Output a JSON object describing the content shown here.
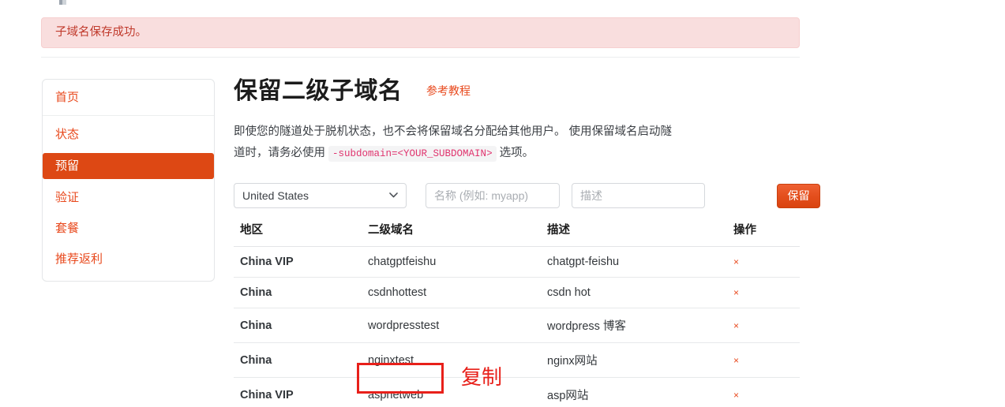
{
  "alert": {
    "message": "子域名保存成功。",
    "type": "danger"
  },
  "sidebar": {
    "header": {
      "label": "首页"
    },
    "items": [
      {
        "label": "状态",
        "active": false
      },
      {
        "label": "预留",
        "active": true
      },
      {
        "label": "验证",
        "active": false
      },
      {
        "label": "套餐",
        "active": false
      },
      {
        "label": "推荐返利",
        "active": false
      }
    ]
  },
  "main": {
    "title": "保留二级子域名",
    "tutorial_link": "参考教程",
    "description_part1": "即使您的隧道处于脱机状态，也不会将保留域名分配给其他用户。 使用保留域名启动隧道时，请务必使用",
    "description_code": "-subdomain=<YOUR_SUBDOMAIN>",
    "description_part2": "选项。"
  },
  "form": {
    "region_selected": "United States",
    "region_options": [
      "United States"
    ],
    "name_value": "",
    "name_placeholder": "名称 (例如: myapp)",
    "desc_value": "",
    "desc_placeholder": "描述",
    "submit_label": "保留",
    "chevron": "❯"
  },
  "table": {
    "headers": [
      "地区",
      "二级域名",
      "描述",
      "操作"
    ],
    "delete_icon": "×",
    "rows": [
      {
        "region": "China VIP",
        "subdomain": "chatgptfeishu",
        "desc": "chatgpt-feishu"
      },
      {
        "region": "China",
        "subdomain": "csdnhottest",
        "desc": "csdn hot"
      },
      {
        "region": "China",
        "subdomain": "wordpresstest",
        "desc": "wordpress 博客"
      },
      {
        "region": "China",
        "subdomain": "nginxtest",
        "desc": "nginx网站"
      },
      {
        "region": "China VIP",
        "subdomain": "aspnetweb",
        "desc": "asp网站"
      }
    ]
  },
  "annotation": {
    "label": "复制",
    "color": "#e8201a"
  },
  "colors": {
    "accent": "#e8491d",
    "active_bg": "#dd4814",
    "alert_bg": "#f9dede",
    "alert_text": "#c0392b",
    "code_text": "#e0346e",
    "annotation": "#e8201a"
  }
}
